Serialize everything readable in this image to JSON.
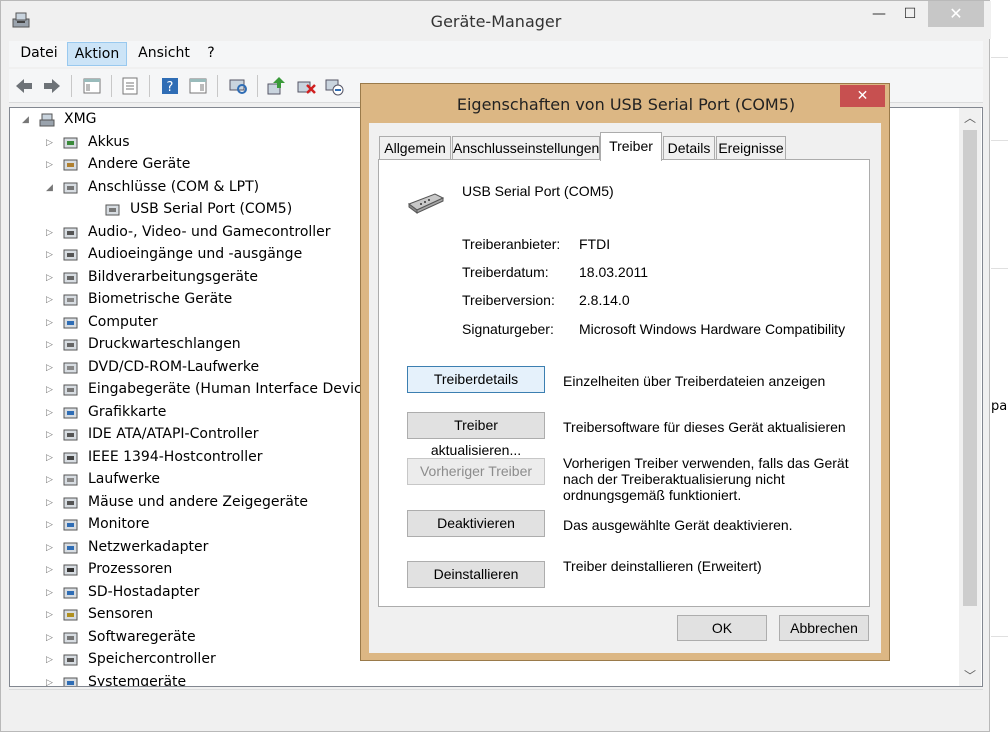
{
  "window": {
    "title": "Geräte-Manager",
    "minimize": "—",
    "maximize": "☐",
    "close": "✕"
  },
  "menu": {
    "items": [
      {
        "label": "Datei"
      },
      {
        "label": "Aktion"
      },
      {
        "label": "Ansicht"
      },
      {
        "label": "?"
      }
    ]
  },
  "toolbar": {
    "icons": [
      "back-arrow-icon",
      "forward-arrow-icon",
      "show-hide-console-tree-icon",
      "properties-icon",
      "help-icon",
      "show-action-pane-icon",
      "scan-hardware-icon",
      "update-driver-icon",
      "uninstall-device-icon",
      "disable-device-icon"
    ]
  },
  "tree": {
    "root": "XMG",
    "items": [
      {
        "label": "Akkus",
        "icon": "battery-icon",
        "expander": "▷"
      },
      {
        "label": "Andere Geräte",
        "icon": "unknown-device-icon",
        "expander": "▷"
      },
      {
        "label": "Anschlüsse (COM & LPT)",
        "icon": "port-icon",
        "expander": "◢"
      },
      {
        "label": "USB Serial Port (COM5)",
        "icon": "serial-port-icon",
        "expander": ""
      },
      {
        "label": "Audio-, Video- und Gamecontroller",
        "icon": "speaker-icon",
        "expander": "▷"
      },
      {
        "label": "Audioeingänge und -ausgänge",
        "icon": "speaker-icon",
        "expander": "▷"
      },
      {
        "label": "Bildverarbeitungsgeräte",
        "icon": "camera-icon",
        "expander": "▷"
      },
      {
        "label": "Biometrische Geräte",
        "icon": "fingerprint-icon",
        "expander": "▷"
      },
      {
        "label": "Computer",
        "icon": "computer-icon",
        "expander": "▷"
      },
      {
        "label": "Druckwarteschlangen",
        "icon": "printer-icon",
        "expander": "▷"
      },
      {
        "label": "DVD/CD-ROM-Laufwerke",
        "icon": "dvd-drive-icon",
        "expander": "▷"
      },
      {
        "label": "Eingabegeräte (Human Interface Devices)",
        "icon": "hid-icon",
        "expander": "▷"
      },
      {
        "label": "Grafikkarte",
        "icon": "display-adapter-icon",
        "expander": "▷"
      },
      {
        "label": "IDE ATA/ATAPI-Controller",
        "icon": "ide-controller-icon",
        "expander": "▷"
      },
      {
        "label": "IEEE 1394-Hostcontroller",
        "icon": "firewire-icon",
        "expander": "▷"
      },
      {
        "label": "Laufwerke",
        "icon": "disk-drive-icon",
        "expander": "▷"
      },
      {
        "label": "Mäuse und andere Zeigegeräte",
        "icon": "mouse-icon",
        "expander": "▷"
      },
      {
        "label": "Monitore",
        "icon": "monitor-icon",
        "expander": "▷"
      },
      {
        "label": "Netzwerkadapter",
        "icon": "network-adapter-icon",
        "expander": "▷"
      },
      {
        "label": "Prozessoren",
        "icon": "processor-icon",
        "expander": "▷"
      },
      {
        "label": "SD-Hostadapter",
        "icon": "sd-host-icon",
        "expander": "▷"
      },
      {
        "label": "Sensoren",
        "icon": "sensor-icon",
        "expander": "▷"
      },
      {
        "label": "Softwaregeräte",
        "icon": "software-device-icon",
        "expander": "▷"
      },
      {
        "label": "Speichercontroller",
        "icon": "storage-controller-icon",
        "expander": "▷"
      },
      {
        "label": "Systemgeräte",
        "icon": "system-device-icon",
        "expander": "▷"
      }
    ]
  },
  "scrollbar": {
    "up": "︿",
    "down": "﹀"
  },
  "partial_text": "par",
  "dialog": {
    "title": "Eigenschaften von USB Serial Port (COM5)",
    "close": "✕",
    "tabs": [
      {
        "label": "Allgemein"
      },
      {
        "label": "Anschlusseinstellungen"
      },
      {
        "label": "Treiber"
      },
      {
        "label": "Details"
      },
      {
        "label": "Ereignisse"
      }
    ],
    "device_name": "USB Serial Port (COM5)",
    "info": [
      {
        "label": "Treiberanbieter:",
        "value": "FTDI"
      },
      {
        "label": "Treiberdatum:",
        "value": "18.03.2011"
      },
      {
        "label": "Treiberversion:",
        "value": "2.8.14.0"
      },
      {
        "label": "Signaturgeber:",
        "value": "Microsoft Windows Hardware Compatibility"
      }
    ],
    "actions": [
      {
        "button": "Treiberdetails",
        "desc": "Einzelheiten über Treiberdateien anzeigen"
      },
      {
        "button": "Treiber aktualisieren...",
        "desc": "Treibersoftware für dieses Gerät aktualisieren"
      },
      {
        "button": "Vorheriger Treiber",
        "desc_lines": [
          "Vorherigen Treiber verwenden, falls das Gerät",
          "nach der Treiberaktualisierung nicht",
          "ordnungsgemäß funktioniert."
        ]
      },
      {
        "button": "Deaktivieren",
        "desc": "Das ausgewählte Gerät deaktivieren."
      },
      {
        "button": "Deinstallieren",
        "desc": "Treiber deinstallieren (Erweitert)"
      }
    ],
    "ok": "OK",
    "cancel": "Abbrechen"
  },
  "colors": {
    "dialog_frame": "#dcb784",
    "close_red": "#c75050",
    "menu_highlight": "#cce4f7"
  }
}
